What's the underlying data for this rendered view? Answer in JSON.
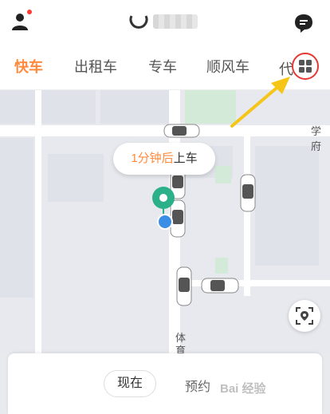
{
  "header": {
    "user_icon": "user-icon",
    "message_icon": "chat-bubble-icon"
  },
  "tabs": [
    {
      "label": "快车",
      "active": true
    },
    {
      "label": "出租车",
      "active": false
    },
    {
      "label": "专车",
      "active": false
    },
    {
      "label": "顺风车",
      "active": false
    },
    {
      "label": "代",
      "active": false
    }
  ],
  "more_button_icon": "grid-icon",
  "map": {
    "road_labels": [
      "学府",
      "体",
      "育"
    ],
    "pickup_tip_prefix": "1分钟后",
    "pickup_tip_suffix": "上车",
    "locate_icon": "locate-icon"
  },
  "booking": {
    "now_label": "现在",
    "reserve_label": "预约"
  },
  "watermark_text": "Bai 经验",
  "colors": {
    "accent": "#ff8a3d",
    "pin": "#2bb089",
    "highlight": "#e53935",
    "arrow": "#f5c518"
  }
}
